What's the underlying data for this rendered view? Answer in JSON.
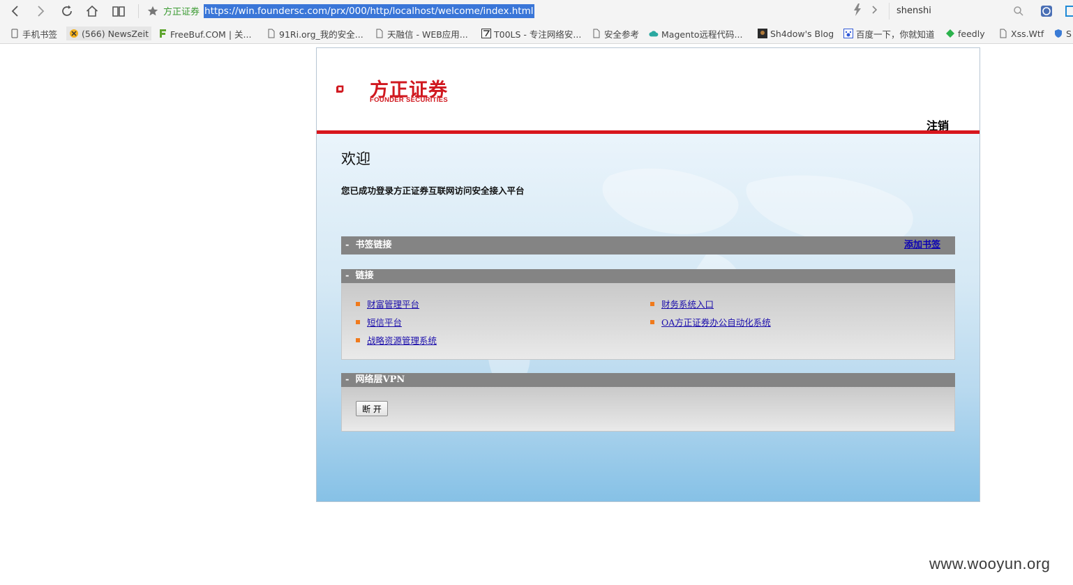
{
  "browser": {
    "site_name": "方正证券",
    "url": "https://win.foundersc.com/prx/000/http/localhost/welcome/index.html",
    "search_value": "shenshi"
  },
  "bookmarks": [
    {
      "label": "手机书签"
    },
    {
      "label": "(566) NewsZeit"
    },
    {
      "label": "FreeBuf.COM | 关..."
    },
    {
      "label": "91Ri.org_我的安全..."
    },
    {
      "label": "天融信 - WEB应用..."
    },
    {
      "label": "T00LS - 专注网络安..."
    },
    {
      "label": "安全参考"
    },
    {
      "label": "Magento远程代码..."
    },
    {
      "label": "Sh4dow's Blog"
    },
    {
      "label": "百度一下，你就知道"
    },
    {
      "label": "feedly"
    },
    {
      "label": "Xss.Wtf"
    },
    {
      "label": "S"
    }
  ],
  "page": {
    "logo_cn": "方正证券",
    "logo_en": "FOUNDER SECURITIES",
    "logout": "注销",
    "welcome_title": "欢迎",
    "welcome_sub": "您已成功登录方正证券互联网访问安全接入平台",
    "bookmark_panel": {
      "toggle": "-",
      "title": "书签链接",
      "add_label": "添加书签"
    },
    "links_panel": {
      "toggle": "-",
      "title": "链接",
      "items": [
        {
          "label": "财富管理平台"
        },
        {
          "label": "财务系统入口"
        },
        {
          "label": "短信平台"
        },
        {
          "label": "OA方正证券办公自动化系统"
        },
        {
          "label": "战略资源管理系统"
        }
      ]
    },
    "vpn_panel": {
      "toggle": "-",
      "title": "网络层VPN",
      "button": "断 开"
    }
  },
  "watermark": "www.wooyun.org",
  "colors": {
    "brand_red": "#d7161d",
    "link_blue": "#1a0dab",
    "panel_gray": "#848484",
    "url_highlight": "#3a76d8",
    "bullet_orange": "#f07a1c"
  }
}
